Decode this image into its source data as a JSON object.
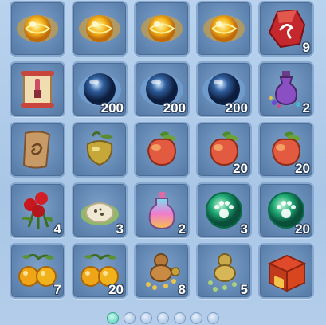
{
  "inventory": {
    "slots": [
      {
        "icon": "golden-sun-orb-icon",
        "count": ""
      },
      {
        "icon": "golden-sun-orb-icon",
        "count": ""
      },
      {
        "icon": "golden-sun-orb-icon",
        "count": ""
      },
      {
        "icon": "golden-sun-orb-icon",
        "count": ""
      },
      {
        "icon": "red-rune-stone-icon",
        "count": "9"
      },
      {
        "icon": "brush-scroll-icon",
        "count": ""
      },
      {
        "icon": "blue-orb-icon",
        "count": "200"
      },
      {
        "icon": "blue-orb-icon",
        "count": "200"
      },
      {
        "icon": "blue-orb-icon",
        "count": "200"
      },
      {
        "icon": "potion-bottle-icon",
        "count": "2"
      },
      {
        "icon": "ancient-scroll-icon",
        "count": ""
      },
      {
        "icon": "golden-fruit-icon",
        "count": ""
      },
      {
        "icon": "peach-icon",
        "count": ""
      },
      {
        "icon": "peach-icon",
        "count": "20"
      },
      {
        "icon": "peach-icon",
        "count": "20"
      },
      {
        "icon": "red-roses-icon",
        "count": "4"
      },
      {
        "icon": "egg-nest-icon",
        "count": "3"
      },
      {
        "icon": "rainbow-potion-icon",
        "count": "2"
      },
      {
        "icon": "green-paw-orb-icon",
        "count": "3"
      },
      {
        "icon": "green-paw-orb-icon",
        "count": "20"
      },
      {
        "icon": "oranges-icon",
        "count": "7"
      },
      {
        "icon": "oranges-icon",
        "count": "20"
      },
      {
        "icon": "gourd-coins-icon",
        "count": "8"
      },
      {
        "icon": "gourd-beads-icon",
        "count": "5"
      },
      {
        "icon": "red-treasure-chest-icon",
        "count": ""
      }
    ]
  },
  "pagination": {
    "pages": 7,
    "current": 1
  },
  "colors": {
    "slot_bg": "#5f84b0",
    "slot_border": "#87a9d0",
    "page_bg": "#b9d3ee",
    "active_dot": "#4bc7b1"
  }
}
